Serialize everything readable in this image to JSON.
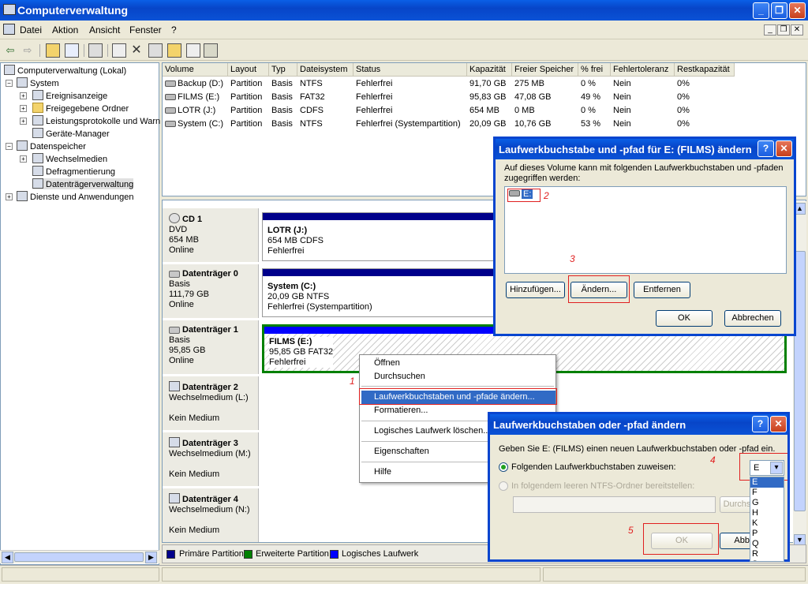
{
  "window": {
    "title": "Computerverwaltung"
  },
  "menu": {
    "items": [
      "Datei",
      "Aktion",
      "Ansicht",
      "Fenster",
      "?"
    ]
  },
  "toolbar": {
    "icons": [
      "back-icon",
      "forward-icon",
      "up-folder-icon",
      "show-tree-icon",
      "properties-icon",
      "refresh-icon",
      "delete-icon",
      "properties2-icon",
      "open-icon",
      "search-icon",
      "settings-icon"
    ]
  },
  "tree": {
    "root": "Computerverwaltung (Lokal)",
    "system": "System",
    "ereignis": "Ereignisanzeige",
    "freigabe": "Freigegebene Ordner",
    "leistung": "Leistungsprotokolle und Warn",
    "geraete": "Geräte-Manager",
    "datenspeicher": "Datenspeicher",
    "wechsel": "Wechselmedien",
    "defrag": "Defragmentierung",
    "dtv": "Datenträgerverwaltung",
    "dienste": "Dienste und Anwendungen"
  },
  "volumes": {
    "headers": [
      "Volume",
      "Layout",
      "Typ",
      "Dateisystem",
      "Status",
      "Kapazität",
      "Freier Speicher",
      "% frei",
      "Fehlertoleranz",
      "Restkapazität"
    ],
    "rows": [
      [
        "Backup (D:)",
        "Partition",
        "Basis",
        "NTFS",
        "Fehlerfrei",
        "91,70 GB",
        "275 MB",
        "0 %",
        "Nein",
        "0%"
      ],
      [
        "FILMS (E:)",
        "Partition",
        "Basis",
        "FAT32",
        "Fehlerfrei",
        "95,83 GB",
        "47,08 GB",
        "49 %",
        "Nein",
        "0%"
      ],
      [
        "LOTR (J:)",
        "Partition",
        "Basis",
        "CDFS",
        "Fehlerfrei",
        "654 MB",
        "0 MB",
        "0 %",
        "Nein",
        "0%"
      ],
      [
        "System (C:)",
        "Partition",
        "Basis",
        "NTFS",
        "Fehlerfrei (Systempartition)",
        "20,09 GB",
        "10,76 GB",
        "53 %",
        "Nein",
        "0%"
      ]
    ]
  },
  "disks": [
    {
      "name": "CD 1",
      "l1": "DVD",
      "l2": "654 MB",
      "l3": "Online",
      "p1": "LOTR  (J:)",
      "p2": "654 MB CDFS",
      "p3": "Fehlerfrei"
    },
    {
      "name": "Datenträger 0",
      "l1": "Basis",
      "l2": "111,79 GB",
      "l3": "Online",
      "p1": "System  (C:)",
      "p2": "20,09 GB NTFS",
      "p3": "Fehlerfrei (Systempartition)"
    },
    {
      "name": "Datenträger 1",
      "l1": "Basis",
      "l2": "95,85 GB",
      "l3": "Online",
      "p1": "FILMS  (E:)",
      "p2": "95,85 GB FAT32",
      "p3": "Fehlerfrei"
    },
    {
      "name": "Datenträger 2",
      "l1": "Wechselmedium (L:)",
      "l2": "",
      "l3": "Kein Medium"
    },
    {
      "name": "Datenträger 3",
      "l1": "Wechselmedium (M:)",
      "l2": "",
      "l3": "Kein Medium"
    },
    {
      "name": "Datenträger 4",
      "l1": "Wechselmedium (N:)",
      "l2": "",
      "l3": "Kein Medium"
    }
  ],
  "legend": {
    "primary": "Primäre Partition",
    "extended": "Erweiterte Partition",
    "logical": "Logisches Laufwerk",
    "c_primary": "#00008b",
    "c_extended": "#008000",
    "c_logical": "#0000ff"
  },
  "context": {
    "items": [
      "Öffnen",
      "Durchsuchen",
      "Laufwerkbuchstaben und -pfade ändern...",
      "Formatieren...",
      "Logisches Laufwerk löschen...",
      "Eigenschaften",
      "Hilfe"
    ]
  },
  "dialog1": {
    "title": "Laufwerkbuchstabe und -pfad für E: (FILMS) ändern",
    "desc": "Auf dieses Volume kann mit folgenden Laufwerkbuchstaben und -pfaden zugegriffen werden:",
    "entry": "E:",
    "add": "Hinzufügen...",
    "change": "Ändern...",
    "remove": "Entfernen",
    "ok": "OK",
    "cancel": "Abbrechen",
    "help": "?",
    "close": "✕"
  },
  "dialog2": {
    "title": "Laufwerkbuchstaben oder -pfad ändern",
    "desc": "Geben Sie E: (FILMS) einen neuen Laufwerkbuchstaben oder -pfad ein.",
    "opt1": "Folgenden Laufwerkbuchstaben zuweisen:",
    "opt2": "In folgendem leeren NTFS-Ordner bereitstellen:",
    "browse": "Durchs",
    "ok": "OK",
    "cancel": "Abbr",
    "selected": "E",
    "options": [
      "E",
      "F",
      "G",
      "H",
      "K",
      "P",
      "Q",
      "R",
      "S"
    ],
    "help": "?",
    "close": "✕"
  },
  "markers": {
    "m1": "1",
    "m2": "2",
    "m3": "3",
    "m4": "4",
    "m5": "5"
  },
  "glyphs": {
    "back": "⇦",
    "forward": "⇨",
    "dropdown": "▾",
    "scroll_left": "◀",
    "scroll_right": "▶",
    "scroll_up": "▲",
    "scroll_down": "▼",
    "minimize": "_",
    "restore": "❐",
    "close": "✕",
    "expand": "+",
    "collapse": "−"
  }
}
